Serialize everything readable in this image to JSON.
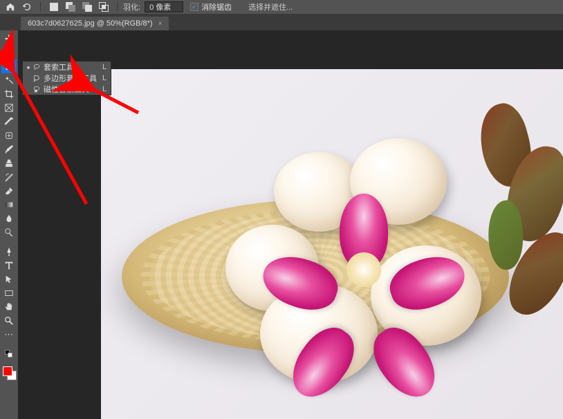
{
  "toolbar": {
    "feather_label": "羽化:",
    "feather_value": "0 像素",
    "antialiasing_label": "消除锯齿",
    "antialiasing_checked": true,
    "select_mask_label": "选择并遮住..."
  },
  "tab": {
    "title": "603c7d0627625.jpg @ 50%(RGB/8*)",
    "close": "×"
  },
  "flyout": {
    "items": [
      {
        "label": "套索工具",
        "shortcut": "L",
        "selected": true,
        "icon": "lasso"
      },
      {
        "label": "多边形套索工具",
        "shortcut": "L",
        "selected": false,
        "icon": "poly-lasso"
      },
      {
        "label": "磁性套索工具",
        "shortcut": "L",
        "selected": false,
        "icon": "mag-lasso"
      }
    ]
  },
  "colors": {
    "foreground": "#ff0000",
    "background": "#ffffff",
    "accent": "#1473e6"
  }
}
